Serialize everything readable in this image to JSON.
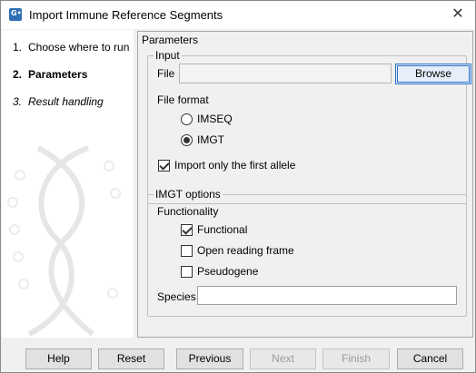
{
  "window": {
    "title": "Import Immune Reference Segments",
    "app_icon_text": "G•",
    "close_glyph": "✕"
  },
  "sidebar": {
    "steps": [
      {
        "num": "1.",
        "label": "Choose where to run"
      },
      {
        "num": "2.",
        "label": "Parameters"
      },
      {
        "num": "3.",
        "label": "Result handling"
      }
    ]
  },
  "content": {
    "title": "Parameters",
    "input": {
      "legend": "Input",
      "file_label": "File",
      "file_value": "",
      "browse_label": "Browse",
      "file_format_label": "File format",
      "options": [
        {
          "label": "IMSEQ",
          "checked": false
        },
        {
          "label": "IMGT",
          "checked": true
        }
      ],
      "first_allele_label": "Import only the first allele",
      "first_allele_checked": true
    },
    "imgt": {
      "legend": "IMGT options",
      "functionality_label": "Functionality",
      "functional_label": "Functional",
      "functional_checked": true,
      "orf_label": "Open reading frame",
      "orf_checked": false,
      "pseudogene_label": "Pseudogene",
      "pseudogene_checked": false,
      "species_label": "Species",
      "species_value": ""
    }
  },
  "footer": {
    "help": "Help",
    "reset": "Reset",
    "previous": "Previous",
    "next": "Next",
    "finish": "Finish",
    "cancel": "Cancel"
  }
}
